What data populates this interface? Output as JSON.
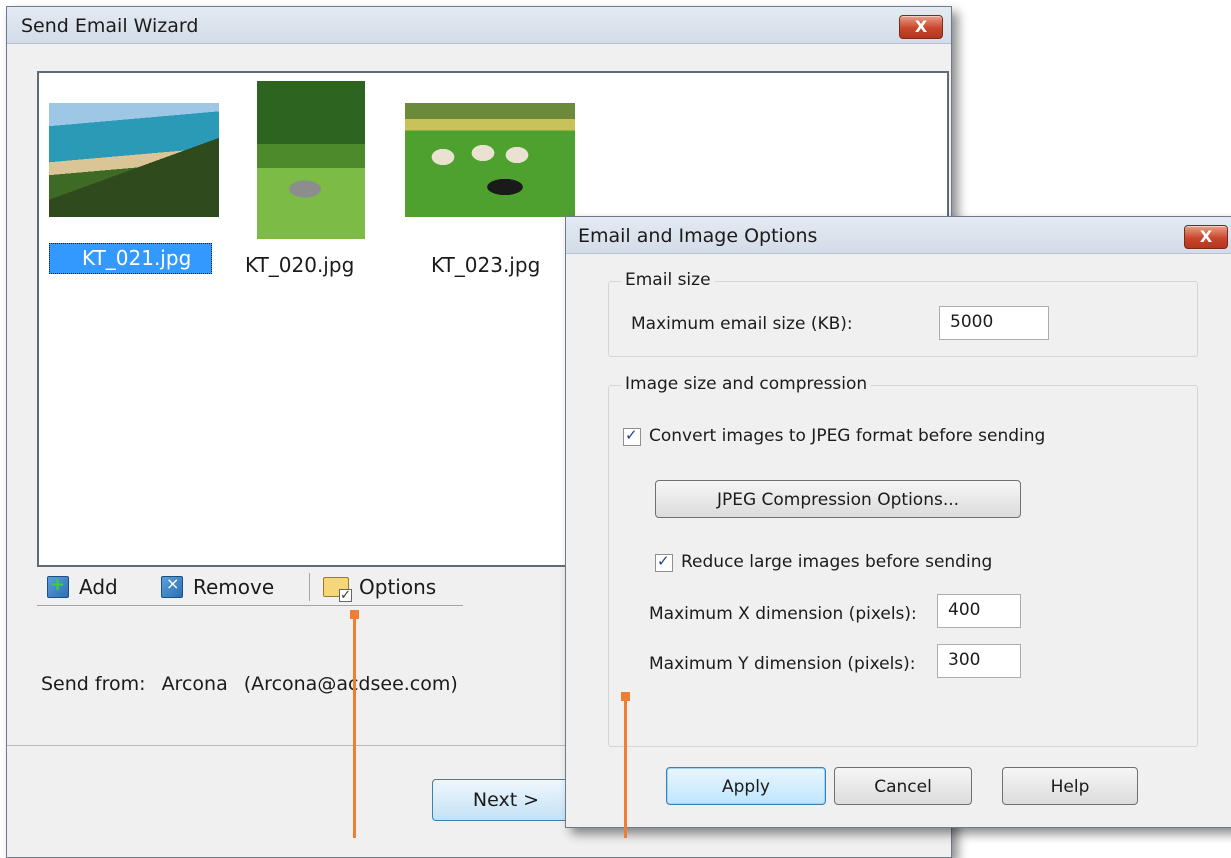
{
  "wizard": {
    "title": "Send Email Wizard",
    "close_label": "X",
    "thumbnails": [
      {
        "filename": "KT_021.jpg",
        "selected": true
      },
      {
        "filename": "KT_020.jpg",
        "selected": false
      },
      {
        "filename": "KT_023.jpg",
        "selected": false
      }
    ],
    "toolbar": {
      "add_label": "Add",
      "remove_label": "Remove",
      "options_label": "Options"
    },
    "send_from": {
      "label": "Send from:",
      "name": "Arcona",
      "email": "(Arcona@acdsee.com)"
    },
    "next_label": "Next >"
  },
  "options_dialog": {
    "title": "Email and Image Options",
    "close_label": "X",
    "email_size": {
      "group_title": "Email size",
      "max_label": "Maximum email size (KB):",
      "max_value": "5000"
    },
    "image_size": {
      "group_title": "Image size and compression",
      "convert_label": "Convert images to JPEG format before sending",
      "convert_checked": true,
      "jpeg_options_label": "JPEG Compression Options...",
      "reduce_label": "Reduce large images before sending",
      "reduce_checked": true,
      "max_x_label": "Maximum X dimension (pixels):",
      "max_x_value": "400",
      "max_y_label": "Maximum Y dimension (pixels):",
      "max_y_value": "300"
    },
    "buttons": {
      "apply": "Apply",
      "cancel": "Cancel",
      "help": "Help"
    }
  },
  "colors": {
    "callout": "#ef7d33",
    "selection": "#3399ff",
    "close_button": "#c9462c"
  }
}
